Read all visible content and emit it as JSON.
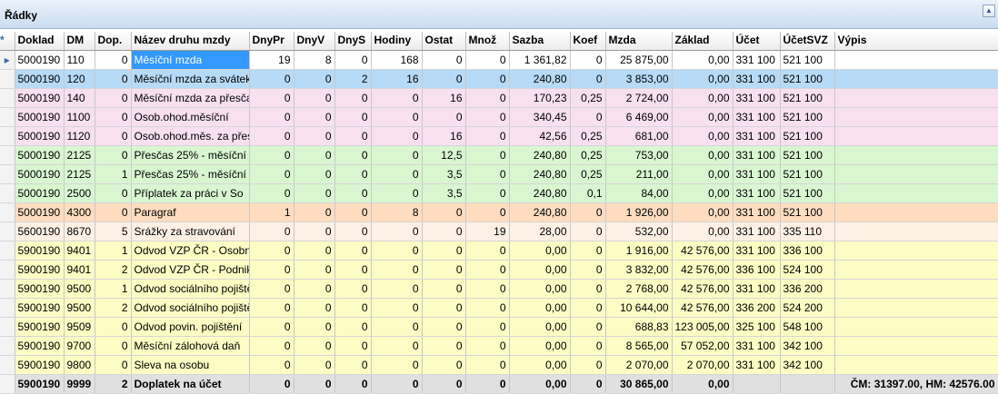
{
  "panel": {
    "title": "Řádky"
  },
  "table": {
    "columns": [
      "Doklad",
      "DM",
      "Dop.",
      "Název druhu mzdy",
      "DnyPr",
      "DnyV",
      "DnyS",
      "Hodiny",
      "Ostat",
      "Množ",
      "Sazba",
      "Koef",
      "Mzda",
      "Základ",
      "Účet",
      "ÚčetSVZ",
      "Výpis"
    ],
    "rows": [
      {
        "bg": "#ffffff",
        "sel": true,
        "cells": [
          "5000190",
          "110",
          "0",
          "Měsíční mzda",
          "19",
          "8",
          "0",
          "168",
          "0",
          "0",
          "1 361,82",
          "0",
          "25 875,00",
          "0,00",
          "331 100",
          "521 100",
          ""
        ]
      },
      {
        "bg": "#b7daf6",
        "cells": [
          "5000190",
          "120",
          "0",
          "Měsíční mzda za svátek",
          "0",
          "0",
          "2",
          "16",
          "0",
          "0",
          "240,80",
          "0",
          "3 853,00",
          "0,00",
          "331 100",
          "521 100",
          ""
        ]
      },
      {
        "bg": "#f8e0f0",
        "cells": [
          "5000190",
          "140",
          "0",
          "Měsíční mzda za přesčas",
          "0",
          "0",
          "0",
          "0",
          "16",
          "0",
          "170,23",
          "0,25",
          "2 724,00",
          "0,00",
          "331 100",
          "521 100",
          ""
        ]
      },
      {
        "bg": "#f8e0f0",
        "cells": [
          "5000190",
          "1100",
          "0",
          "Osob.ohod.měsíční",
          "0",
          "0",
          "0",
          "0",
          "0",
          "0",
          "340,45",
          "0",
          "6 469,00",
          "0,00",
          "331 100",
          "521 100",
          ""
        ]
      },
      {
        "bg": "#f8e0f0",
        "cells": [
          "5000190",
          "1120",
          "0",
          "Osob.ohod.měs. za přesčas",
          "0",
          "0",
          "0",
          "0",
          "16",
          "0",
          "42,56",
          "0,25",
          "681,00",
          "0,00",
          "331 100",
          "521 100",
          ""
        ]
      },
      {
        "bg": "#d8f7d0",
        "cells": [
          "5000190",
          "2125",
          "0",
          "Přesčas 25% - měsíční",
          "0",
          "0",
          "0",
          "0",
          "12,5",
          "0",
          "240,80",
          "0,25",
          "753,00",
          "0,00",
          "331 100",
          "521 100",
          ""
        ]
      },
      {
        "bg": "#d8f7d0",
        "cells": [
          "5000190",
          "2125",
          "1",
          "Přesčas 25% - měsíční",
          "0",
          "0",
          "0",
          "0",
          "3,5",
          "0",
          "240,80",
          "0,25",
          "211,00",
          "0,00",
          "331 100",
          "521 100",
          ""
        ]
      },
      {
        "bg": "#d8f7d0",
        "cells": [
          "5000190",
          "2500",
          "0",
          "Příplatek za práci v So",
          "0",
          "0",
          "0",
          "0",
          "3,5",
          "0",
          "240,80",
          "0,1",
          "84,00",
          "0,00",
          "331 100",
          "521 100",
          ""
        ]
      },
      {
        "bg": "#fddcc0",
        "cells": [
          "5000190",
          "4300",
          "0",
          "Paragraf",
          "1",
          "0",
          "0",
          "8",
          "0",
          "0",
          "240,80",
          "0",
          "1 926,00",
          "0,00",
          "331 100",
          "521 100",
          ""
        ]
      },
      {
        "bg": "#fdf0e4",
        "cells": [
          "5600190",
          "8670",
          "5",
          "Srážky za stravování",
          "0",
          "0",
          "0",
          "0",
          "0",
          "19",
          "28,00",
          "0",
          "532,00",
          "0,00",
          "331 100",
          "335 110",
          ""
        ]
      },
      {
        "bg": "#fdfcc4",
        "cells": [
          "5900190",
          "9401",
          "1",
          "Odvod VZP ČR - Osobní",
          "0",
          "0",
          "0",
          "0",
          "0",
          "0",
          "0,00",
          "0",
          "1 916,00",
          "42 576,00",
          "331 100",
          "336 100",
          ""
        ]
      },
      {
        "bg": "#fdfcc4",
        "cells": [
          "5900190",
          "9401",
          "2",
          "Odvod VZP ČR - Podnik",
          "0",
          "0",
          "0",
          "0",
          "0",
          "0",
          "0,00",
          "0",
          "3 832,00",
          "42 576,00",
          "336 100",
          "524 100",
          ""
        ]
      },
      {
        "bg": "#fdfcc4",
        "cells": [
          "5900190",
          "9500",
          "1",
          "Odvod sociálního pojištění",
          "0",
          "0",
          "0",
          "0",
          "0",
          "0",
          "0,00",
          "0",
          "2 768,00",
          "42 576,00",
          "331 100",
          "336 200",
          ""
        ]
      },
      {
        "bg": "#fdfcc4",
        "cells": [
          "5900190",
          "9500",
          "2",
          "Odvod sociálního pojištění",
          "0",
          "0",
          "0",
          "0",
          "0",
          "0",
          "0,00",
          "0",
          "10 644,00",
          "42 576,00",
          "336 200",
          "524 200",
          ""
        ]
      },
      {
        "bg": "#fdfcc4",
        "cells": [
          "5900190",
          "9509",
          "0",
          "Odvod povin. pojištění",
          "0",
          "0",
          "0",
          "0",
          "0",
          "0",
          "0,00",
          "0",
          "688,83",
          "123 005,00",
          "325 100",
          "548 100",
          ""
        ]
      },
      {
        "bg": "#fdfcc4",
        "cells": [
          "5900190",
          "9700",
          "0",
          "Měsíční zálohová daň",
          "0",
          "0",
          "0",
          "0",
          "0",
          "0",
          "0,00",
          "0",
          "8 565,00",
          "57 052,00",
          "331 100",
          "342 100",
          ""
        ]
      },
      {
        "bg": "#fdfcc4",
        "cells": [
          "5900190",
          "9800",
          "0",
          "Sleva na osobu",
          "0",
          "0",
          "0",
          "0",
          "0",
          "0",
          "0,00",
          "0",
          "2 070,00",
          "2 070,00",
          "331 100",
          "342 100",
          ""
        ]
      },
      {
        "bg": "#e0e0e0",
        "total": true,
        "cells": [
          "5900190",
          "9999",
          "2",
          "Doplatek na účet",
          "0",
          "0",
          "0",
          "0",
          "0",
          "0",
          "0,00",
          "0",
          "30 865,00",
          "0,00",
          "",
          "",
          "ČM: 31397.00, HM: 42576.00"
        ]
      }
    ]
  }
}
